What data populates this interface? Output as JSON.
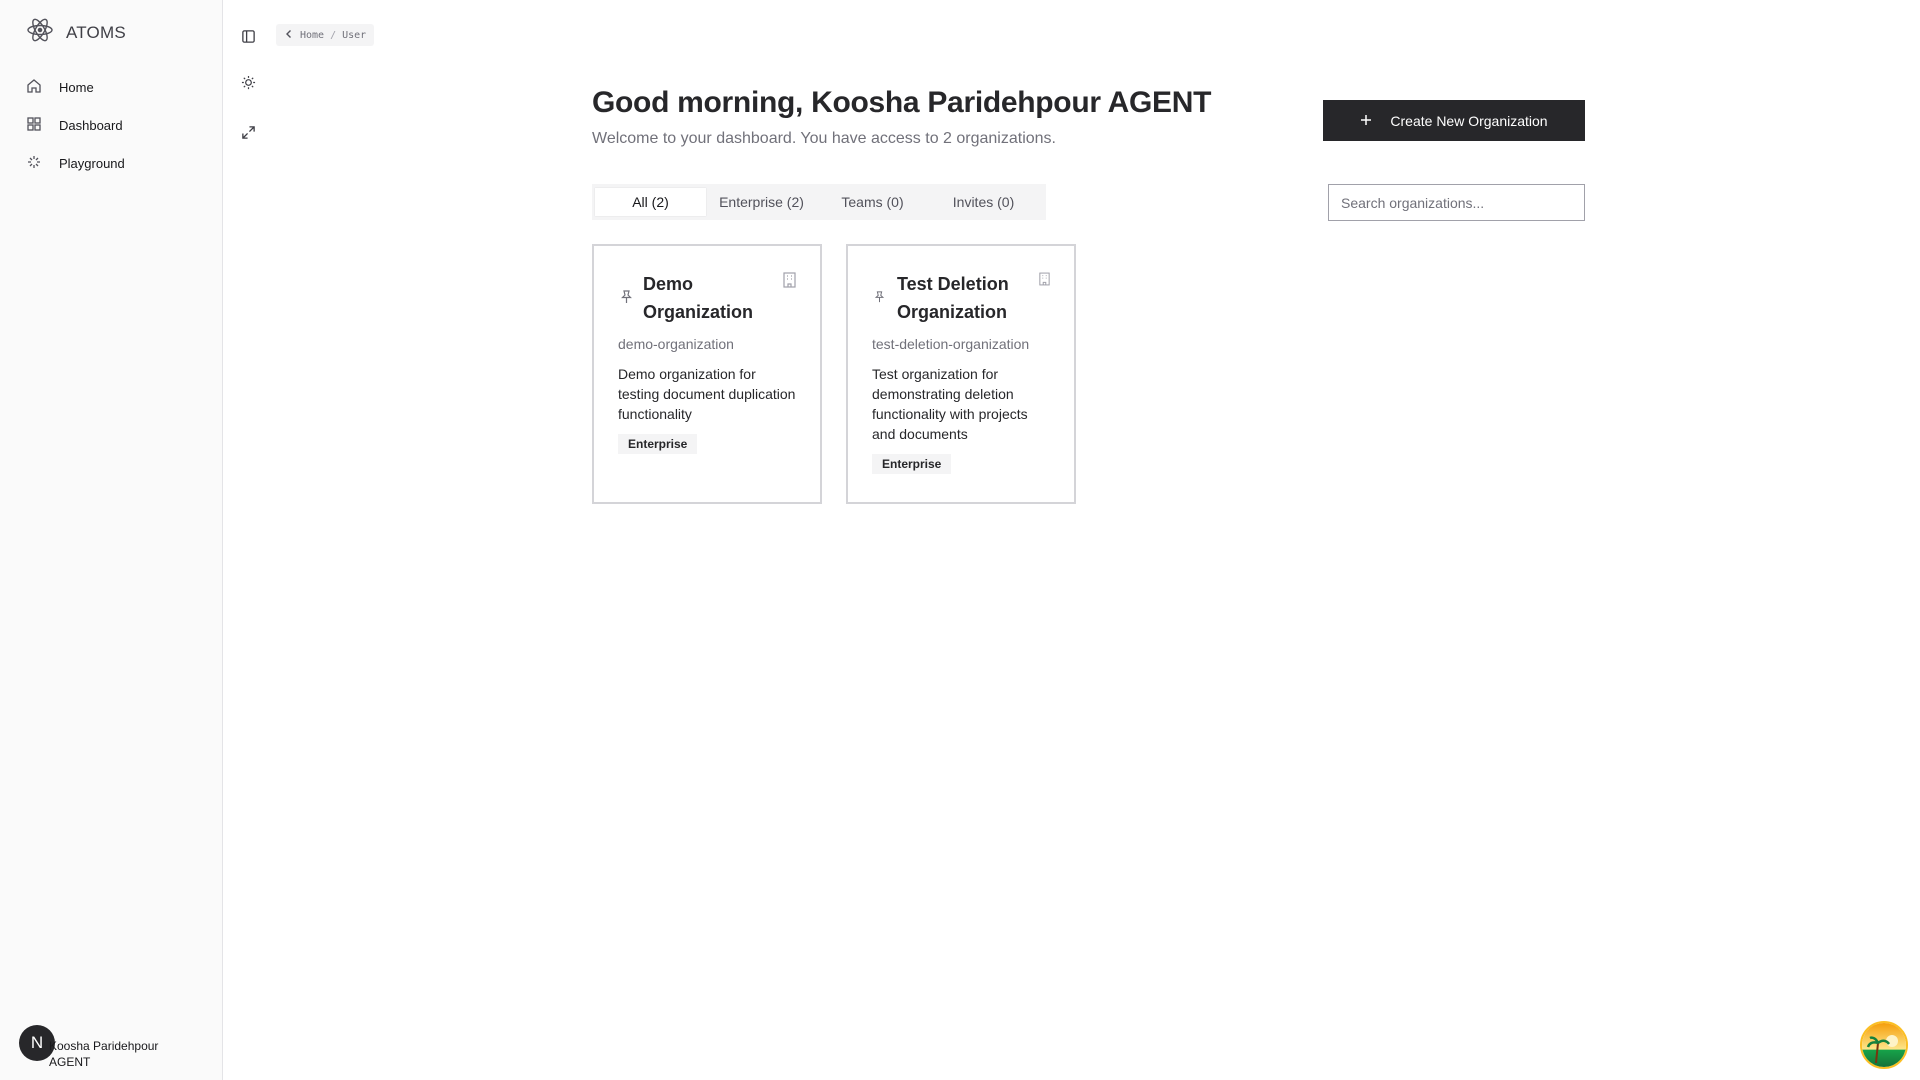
{
  "sidebar": {
    "brand": "ATOMS",
    "items": [
      {
        "label": "Home",
        "icon": "home-icon"
      },
      {
        "label": "Dashboard",
        "icon": "dashboard-grid-icon"
      },
      {
        "label": "Playground",
        "icon": "sparkle-icon"
      }
    ],
    "user": {
      "initial": "N",
      "name": "Koosha Paridehpour AGENT"
    }
  },
  "breadcrumb": {
    "items": [
      "Home",
      "User"
    ],
    "separator": "/"
  },
  "header": {
    "greeting": "Good morning, Koosha Paridehpour AGENT",
    "welcome": "Welcome to your dashboard. You have access to 2 organizations.",
    "create_label": "Create New Organization"
  },
  "tabs": [
    {
      "label": "All (2)",
      "active": true
    },
    {
      "label": "Enterprise (2)",
      "active": false
    },
    {
      "label": "Teams (0)",
      "active": false
    },
    {
      "label": "Invites (0)",
      "active": false
    }
  ],
  "search": {
    "placeholder": "Search organizations..."
  },
  "organizations": [
    {
      "name": "Demo Organization",
      "slug": "demo-organization",
      "description": "Demo organization for testing document duplication functionality",
      "badge": "Enterprise"
    },
    {
      "name": "Test Deletion Organization",
      "slug": "test-deletion-organization",
      "description": "Test organization for demonstrating deletion functionality with projects and documents",
      "badge": "Enterprise"
    }
  ],
  "colors": {
    "accent": "#27272a",
    "sidebar_bg": "#fafafa",
    "tab_bg": "#f4f4f5"
  }
}
